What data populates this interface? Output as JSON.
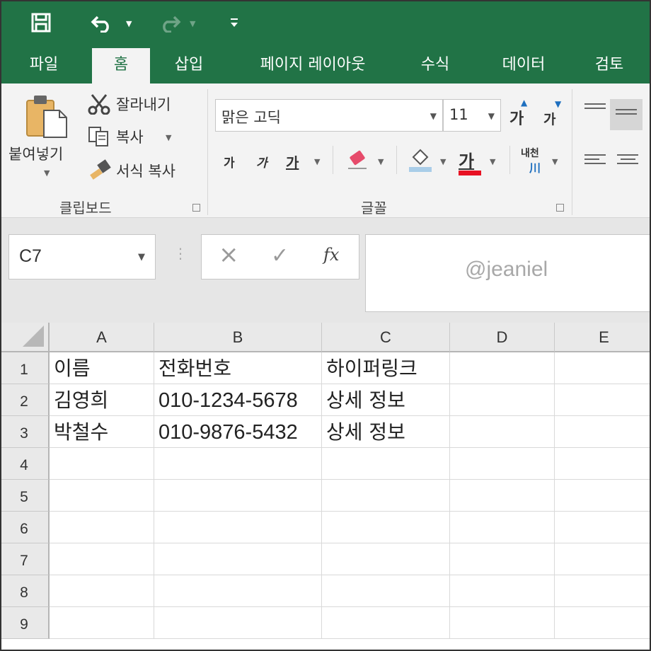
{
  "quick_access": {
    "save_icon": "save-icon",
    "undo_icon": "undo-icon",
    "redo_icon": "redo-icon",
    "customize_icon": "customize-quick-access-icon"
  },
  "tabs": [
    {
      "label": "파일",
      "active": false
    },
    {
      "label": "홈",
      "active": true
    },
    {
      "label": "삽입",
      "active": false
    },
    {
      "label": "페이지 레이아웃",
      "active": false
    },
    {
      "label": "수식",
      "active": false
    },
    {
      "label": "데이터",
      "active": false
    },
    {
      "label": "검토",
      "active": false
    }
  ],
  "ribbon": {
    "clipboard": {
      "paste_label": "붙여넣기",
      "cut_label": "잘라내기",
      "copy_label": "복사",
      "format_painter_label": "서식 복사",
      "group_label": "클립보드"
    },
    "font": {
      "font_name": "맑은 고딕",
      "font_size": "11",
      "grow_label": "가",
      "shrink_label": "가",
      "bold_label": "가",
      "italic_label": "가",
      "underline_label": "가",
      "font_color_label": "가",
      "phonetic_top": "내천",
      "phonetic_bottom": "川",
      "group_label": "글꼴",
      "font_color": "#e81123",
      "fill_color": "#a9cde8"
    }
  },
  "formula_bar": {
    "name_box": "C7",
    "cancel_icon": "×",
    "enter_icon": "✓",
    "fx_label": "fx",
    "watermark": "@jeaniel"
  },
  "sheet": {
    "columns": [
      "A",
      "B",
      "C",
      "D",
      "E"
    ],
    "rows": [
      "1",
      "2",
      "3",
      "4",
      "5",
      "6",
      "7",
      "8",
      "9"
    ],
    "cells": [
      [
        "이름",
        "전화번호",
        "하이퍼링크",
        "",
        ""
      ],
      [
        "김영희",
        "010-1234-5678",
        "상세 정보",
        "",
        ""
      ],
      [
        "박철수",
        "010-9876-5432",
        "상세 정보",
        "",
        ""
      ]
    ]
  },
  "colors": {
    "brand": "#217346",
    "ribbon_bg": "#f3f3f3"
  }
}
